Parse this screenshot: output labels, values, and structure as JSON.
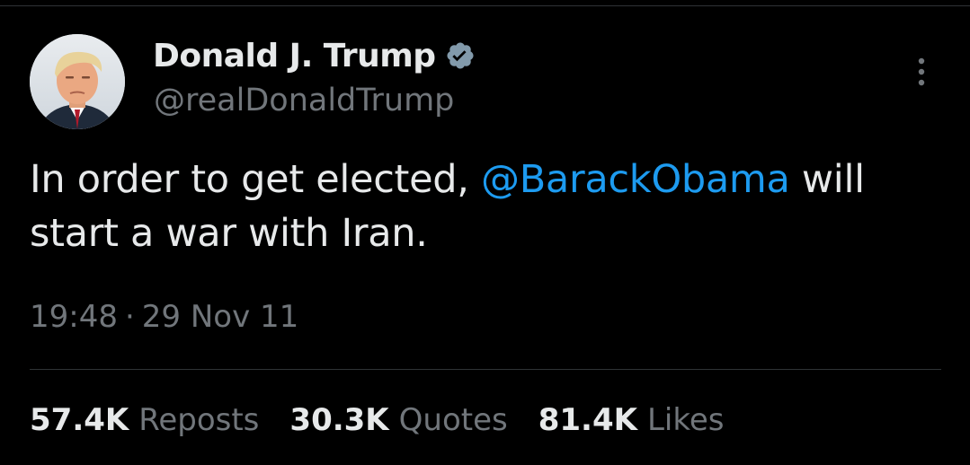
{
  "colors": {
    "background": "#000000",
    "text_primary": "#e7e9ea",
    "text_secondary": "#71767b",
    "accent_link": "#1d9bf0",
    "divider": "#2f3336"
  },
  "author": {
    "display_name": "Donald J. Trump",
    "handle": "@realDonaldTrump",
    "verified_icon": "verified-badge-icon",
    "avatar": "profile-photo"
  },
  "more_menu_icon": "more-vertical-icon",
  "tweet": {
    "text_before": "In order to get elected, ",
    "mention": "@BarackObama",
    "text_after": " will start a war with Iran."
  },
  "meta": {
    "time": "19:48",
    "separator": "·",
    "date": "29 Nov 11"
  },
  "stats": [
    {
      "count": "57.4K",
      "label": "Reposts"
    },
    {
      "count": "30.3K",
      "label": "Quotes"
    },
    {
      "count": "81.4K",
      "label": "Likes"
    }
  ]
}
